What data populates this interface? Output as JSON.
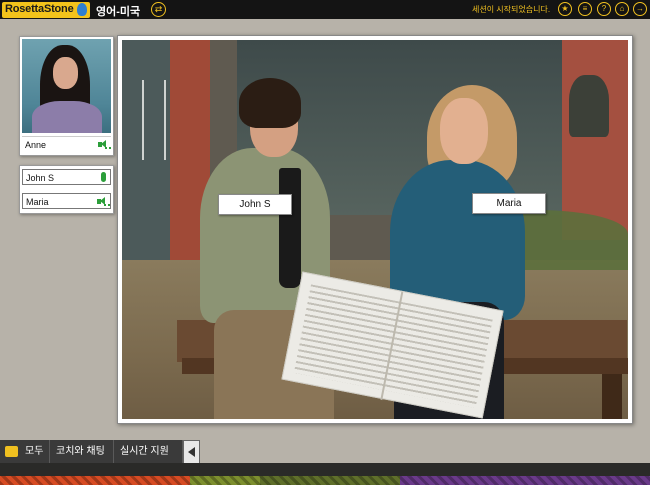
{
  "app": {
    "brand": "RosettaStone",
    "course_language": "영어-미국",
    "session_status": "세션이 시작되었습니다."
  },
  "toolbar": {
    "icons": [
      "star-icon",
      "menu-icon",
      "help-icon",
      "home-icon",
      "exit-icon"
    ]
  },
  "coach": {
    "name": "Anne",
    "audio": "speaker-icon"
  },
  "participants": [
    {
      "name": "John S",
      "status_icon": "microphone-icon"
    },
    {
      "name": "Maria",
      "status_icon": "speaker-icon"
    }
  ],
  "scene_labels": [
    {
      "name": "John S"
    },
    {
      "name": "Maria"
    }
  ],
  "bottom_tabs": [
    {
      "label": "모두"
    },
    {
      "label": "코치와 채팅"
    },
    {
      "label": "실시간 지원"
    }
  ],
  "colors": {
    "brand_yellow": "#f3c31b",
    "accent_green": "#2c9e3a",
    "topbar": "#141414"
  }
}
